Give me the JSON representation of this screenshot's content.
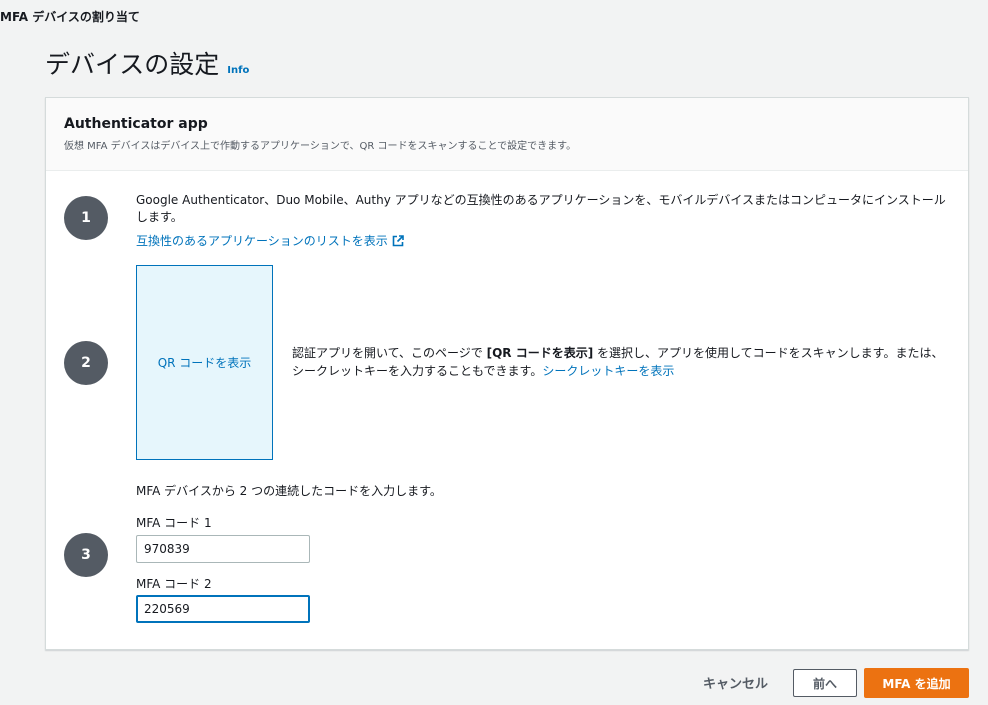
{
  "breadcrumb": "MFA デバイスの割り当て",
  "page": {
    "title": "デバイスの設定",
    "info_label": "Info"
  },
  "panel": {
    "title": "Authenticator app",
    "description": "仮想 MFA デバイスはデバイス上で作動するアプリケーションで、QR コードをスキャンすることで設定できます。"
  },
  "steps": {
    "step1": {
      "number": "1",
      "text": "Google Authenticator、Duo Mobile、Authy アプリなどの互換性のあるアプリケーションを、モバイルデバイスまたはコンピュータにインストールします。",
      "link": "互換性のあるアプリケーションのリストを表示"
    },
    "step2": {
      "number": "2",
      "qr_button": "QR コードを表示",
      "text_before": "認証アプリを開いて、このページで ",
      "text_bold": "[QR コードを表示]",
      "text_after": " を選択し、アプリを使用してコードをスキャンします。または、シークレットキーを入力することもできます。",
      "secret_link": "シークレットキーを表示"
    },
    "step3": {
      "number": "3",
      "text": "MFA デバイスから 2 つの連続したコードを入力します。",
      "code1_label": "MFA コード 1",
      "code1_value": "970839",
      "code2_label": "MFA コード 2",
      "code2_value": "220569"
    }
  },
  "footer": {
    "cancel": "キャンセル",
    "previous": "前へ",
    "submit": "MFA を追加"
  },
  "colors": {
    "link": "#0073bb",
    "primary": "#ec7211",
    "step_circle": "#545b64"
  }
}
